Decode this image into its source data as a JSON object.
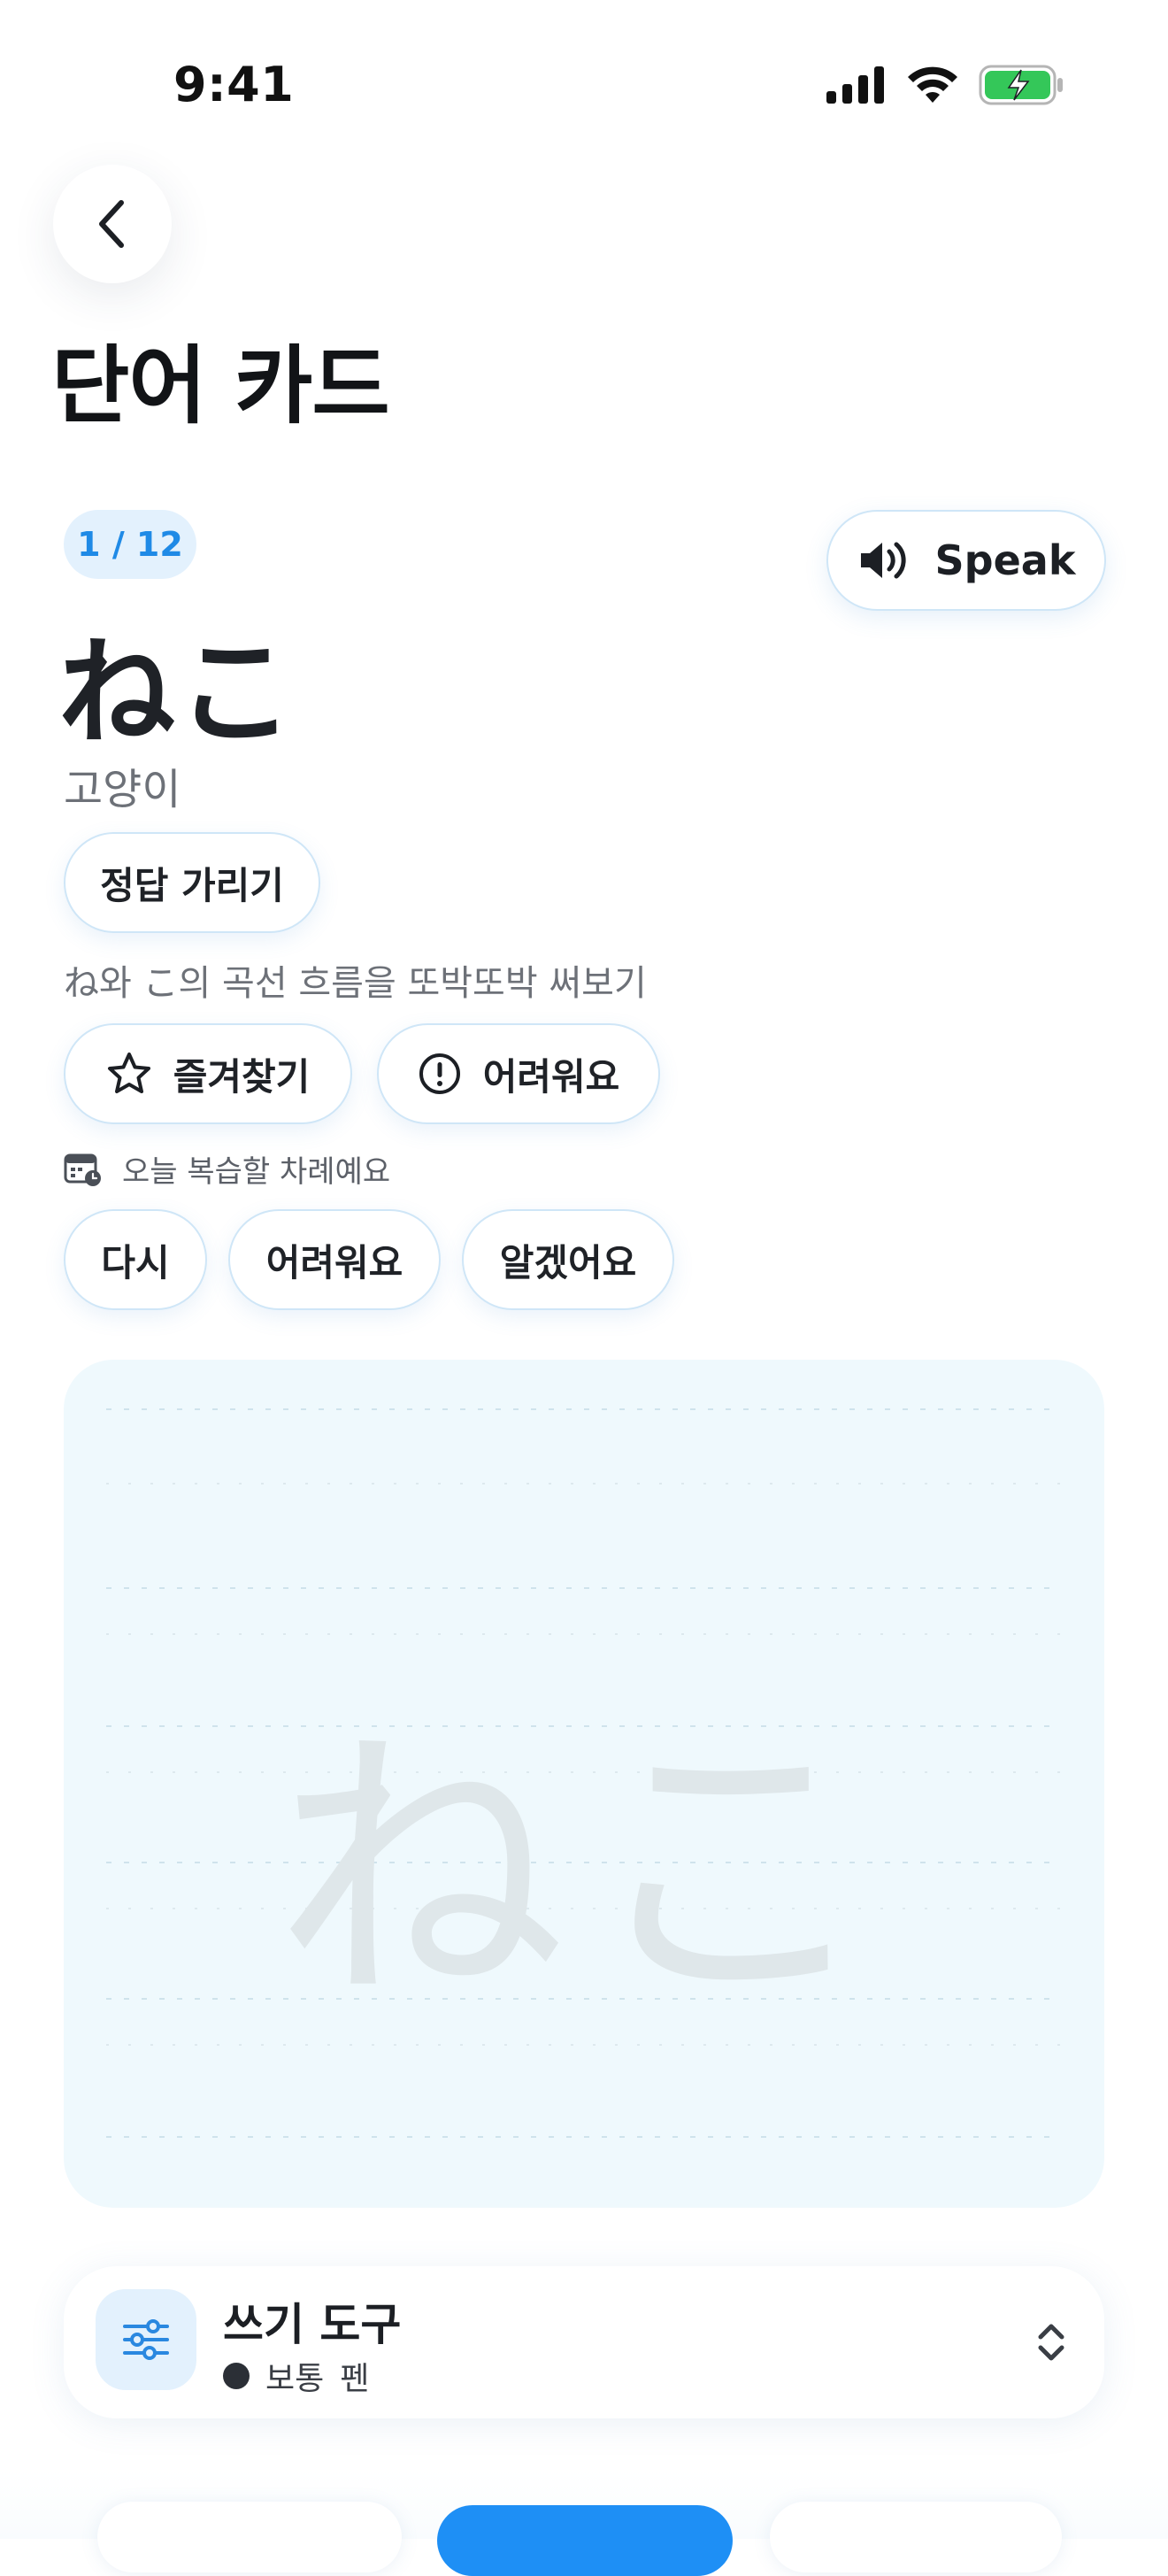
{
  "status_bar": {
    "time": "9:41"
  },
  "header": {
    "title": "단어 카드"
  },
  "card": {
    "progress": "1 / 12",
    "speak_label": "Speak",
    "word": "ねこ",
    "meaning": "고양이",
    "hide_answer_label": "정답 가리기",
    "stroke_hint": "ね와 こ의 곡선 흐름을 또박또박 써보기",
    "favorite_label": "즐겨찾기",
    "difficult_label": "어려워요",
    "review_note": "오늘 복습할 차례예요",
    "rating": {
      "again": "다시",
      "hard": "어려워요",
      "good": "알겠어요"
    }
  },
  "canvas": {
    "ghost_text": "ねこ"
  },
  "writing_tool": {
    "title": "쓰기 도구",
    "thickness": "보통",
    "tool": "펜"
  },
  "colors": {
    "accent": "#1e8ff5",
    "badge_bg": "#e3f1fd",
    "canvas_bg": "#eff9fd",
    "battery_green": "#34c759"
  }
}
